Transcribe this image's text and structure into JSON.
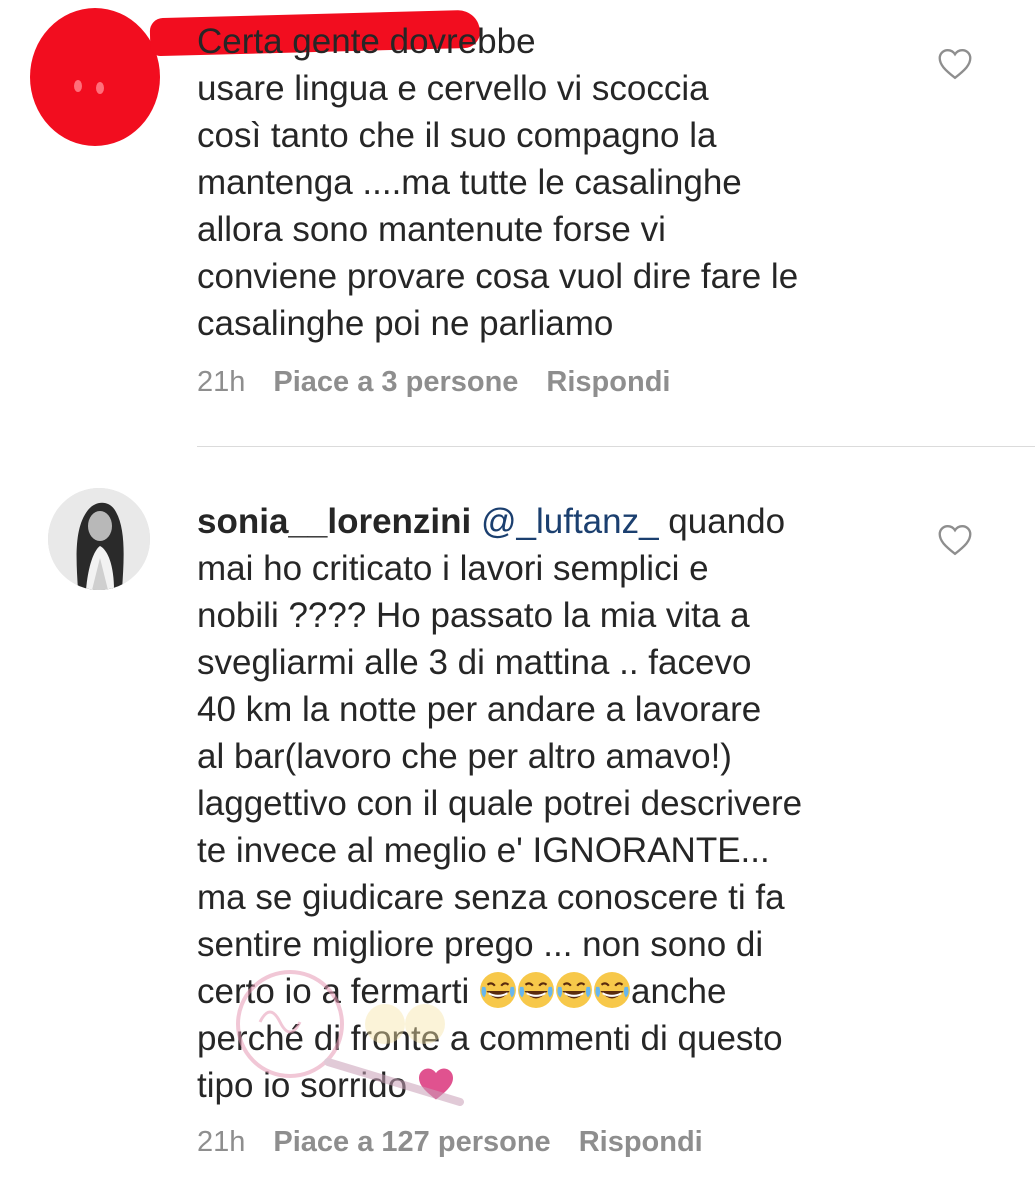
{
  "comments": [
    {
      "text": "Certa gente dovrebbe\nusare lingua e cervello vi scoccia\ncosì tanto che il suo compagno la\nmantenga ....ma tutte le casalinghe\nallora sono mantenute forse vi\nconviene provare cosa vuol dire fare le\ncasalinghe poi ne parliamo",
      "time": "21h",
      "likes": "Piace a 3 persone",
      "reply": "Rispondi",
      "like_icon": "heart-outline-icon"
    },
    {
      "username": "sonia__lorenzini",
      "mention": "@_luftanz_",
      "text_lead": " quando\nmai ho criticato i lavori semplici e\nnobili ???? Ho passato la mia vita a\nsvegliarmi alle 3 di mattina .. facevo\n40 km la notte per andare a lavorare\nal bar(lavoro che per altro amavo!)\nlaggettivo con il quale potrei descrivere\nte invece al meglio e' IGNORANTE...\nma se giudicare senza conoscere ti fa\nsentire migliore prego ... non sono di\ncerto io a fermarti ",
      "text_mid": "anche\nperché di fronte a commenti di questo\ntipo io sorrido ",
      "emoji_name": "face-with-tears-of-joy-emoji",
      "emoji_count": 4,
      "end_emoji": "pink-heart-emoji",
      "time": "21h",
      "likes": "Piace a 127 persone",
      "reply": "Rispondi",
      "like_icon": "heart-outline-icon"
    }
  ],
  "colors": {
    "text": "#262626",
    "meta": "#8e8e8e",
    "mention": "#1b3f6f",
    "redaction": "#f20d1f",
    "divider": "#dbdbdb"
  }
}
